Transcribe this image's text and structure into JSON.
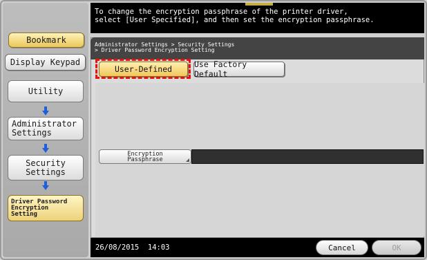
{
  "message": {
    "line1": "To change the encryption passphrase of the printer driver,",
    "line2": "select [User Specified], and then set the encryption passphrase."
  },
  "sidebar": {
    "bookmark_label": "Bookmark",
    "display_keypad_label": "Display Keypad",
    "nav": [
      {
        "label": "Utility"
      },
      {
        "label": "Administrator\nSettings"
      },
      {
        "label": "Security\nSettings"
      },
      {
        "label": "Driver Password\nEncryption\nSetting"
      }
    ]
  },
  "breadcrumb": {
    "line1": "Administrator Settings > Security Settings",
    "line2": "> Driver Password Encryption Setting"
  },
  "options": {
    "user_defined_label": "User-Defined",
    "factory_default_label": "Use Factory Default",
    "selected": "User-Defined"
  },
  "encryption": {
    "label": "Encryption\nPassphrase",
    "value": ""
  },
  "footer": {
    "date": "26/08/2015",
    "time": "14:03",
    "cancel_label": "Cancel",
    "ok_label": "OK"
  },
  "colors": {
    "highlight": "#e8120a",
    "selected_gold": "#f0c75c",
    "arrow_blue": "#1f5fd8"
  }
}
